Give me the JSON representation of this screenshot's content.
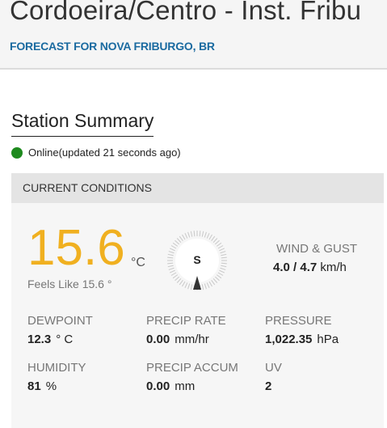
{
  "header": {
    "station_title": "Cordoeira/Centro - Inst. Fribu",
    "forecast_link": "FORECAST FOR NOVA FRIBURGO, BR"
  },
  "summary": {
    "title": "Station Summary",
    "status_text": "Online(updated 21 seconds ago)",
    "status_color": "#1e8a1e"
  },
  "conditions": {
    "header": "CURRENT CONDITIONS",
    "temperature": "15.6",
    "temperature_unit": "°C",
    "feels_like": "Feels Like 15.6 °",
    "wind_direction": "S",
    "wind_label": "WIND & GUST",
    "wind_speed": "4.0",
    "wind_gust": "/ 4.7",
    "wind_unit": "km/h",
    "stats": {
      "dewpoint": {
        "label": "DEWPOINT",
        "value": "12.3",
        "unit": "° C"
      },
      "precip_rate": {
        "label": "PRECIP RATE",
        "value": "0.00",
        "unit": "mm/hr"
      },
      "pressure": {
        "label": "PRESSURE",
        "value": "1,022.35",
        "unit": "hPa"
      },
      "humidity": {
        "label": "HUMIDITY",
        "value": "81",
        "unit": "%"
      },
      "precip_accum": {
        "label": "PRECIP ACCUM",
        "value": "0.00",
        "unit": "mm"
      },
      "uv": {
        "label": "UV",
        "value": "2",
        "unit": ""
      }
    }
  },
  "colors": {
    "temperature": "#f0b020",
    "link": "#1a6aa0"
  }
}
